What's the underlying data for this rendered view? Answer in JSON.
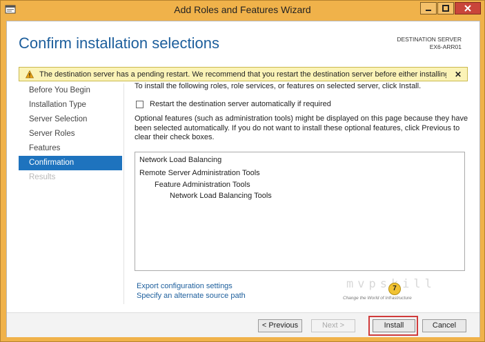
{
  "window": {
    "title": "Add Roles and Features Wizard"
  },
  "header": {
    "title": "Confirm installation selections",
    "destination_label": "DESTINATION SERVER",
    "destination_server": "EX6-ARR01"
  },
  "warning": {
    "text": "The destination server has a pending restart. We recommend that you restart the destination server before either installing o..."
  },
  "nav": {
    "items": [
      {
        "label": "Before You Begin",
        "state": "normal"
      },
      {
        "label": "Installation Type",
        "state": "normal"
      },
      {
        "label": "Server Selection",
        "state": "normal"
      },
      {
        "label": "Server Roles",
        "state": "normal"
      },
      {
        "label": "Features",
        "state": "normal"
      },
      {
        "label": "Confirmation",
        "state": "active"
      },
      {
        "label": "Results",
        "state": "disabled"
      }
    ]
  },
  "content": {
    "intro": "To install the following roles, role services, or features on selected server, click Install.",
    "restart_checkbox_label": "Restart the destination server automatically if required",
    "restart_checked": false,
    "optional_note": "Optional features (such as administration tools) might be displayed on this page because they have been selected automatically. If you do not want to install these optional features, click Previous to clear their check boxes.",
    "items": [
      {
        "label": "Network Load Balancing",
        "level": 0
      },
      {
        "label": "Remote Server Administration Tools",
        "level": 0
      },
      {
        "label": "Feature Administration Tools",
        "level": 1
      },
      {
        "label": "Network Load Balancing Tools",
        "level": 2
      }
    ]
  },
  "links": {
    "export": "Export configuration settings",
    "alternate_source": "Specify an alternate source path"
  },
  "watermark": {
    "logo": "mvpskill",
    "tagline": "Change the World of Infrastructure"
  },
  "annotation": {
    "step": "7"
  },
  "buttons": {
    "previous": "< Previous",
    "next": "Next >",
    "install": "Install",
    "cancel": "Cancel"
  },
  "colors": {
    "frame": "#f0b24a",
    "accent": "#1e73be",
    "title_blue": "#1c5e9c",
    "warning_bg": "#fbf3b7",
    "highlight_red": "#d03a3a"
  }
}
